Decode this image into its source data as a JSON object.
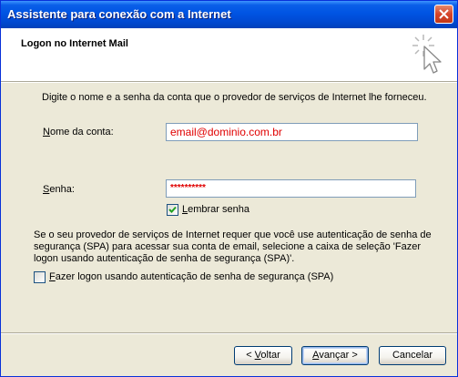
{
  "window": {
    "title": "Assistente para conexão com a Internet",
    "close_label": "close"
  },
  "header": {
    "title": "Logon no Internet Mail",
    "icon": "wizard-star-cursor-icon"
  },
  "content": {
    "intro": "Digite o nome e a senha da conta que o provedor de serviços de Internet lhe forneceu.",
    "account_name": {
      "label_hotkey": "N",
      "label_rest": "ome da conta:",
      "value": "email@dominio.com.br"
    },
    "password": {
      "label_hotkey": "S",
      "label_rest": "enha:",
      "value": "**********"
    },
    "remember_password": {
      "label_hotkey": "L",
      "label_rest": "embrar senha",
      "checked": true
    },
    "spa_paragraph": "Se o seu provedor de serviços de Internet requer que você use autenticação de senha de segurança (SPA) para acessar sua conta de email, selecione a caixa de seleção 'Fazer logon usando autenticação de senha de segurança (SPA)'.",
    "spa_checkbox": {
      "label_hotkey": "F",
      "label_rest": "azer logon usando autenticação de senha de segurança (SPA)",
      "checked": false
    }
  },
  "buttons": {
    "back_prefix": "< ",
    "back_hotkey": "V",
    "back_rest": "oltar",
    "next_hotkey": "A",
    "next_rest": "vançar",
    "next_suffix": " >",
    "cancel": "Cancelar"
  }
}
